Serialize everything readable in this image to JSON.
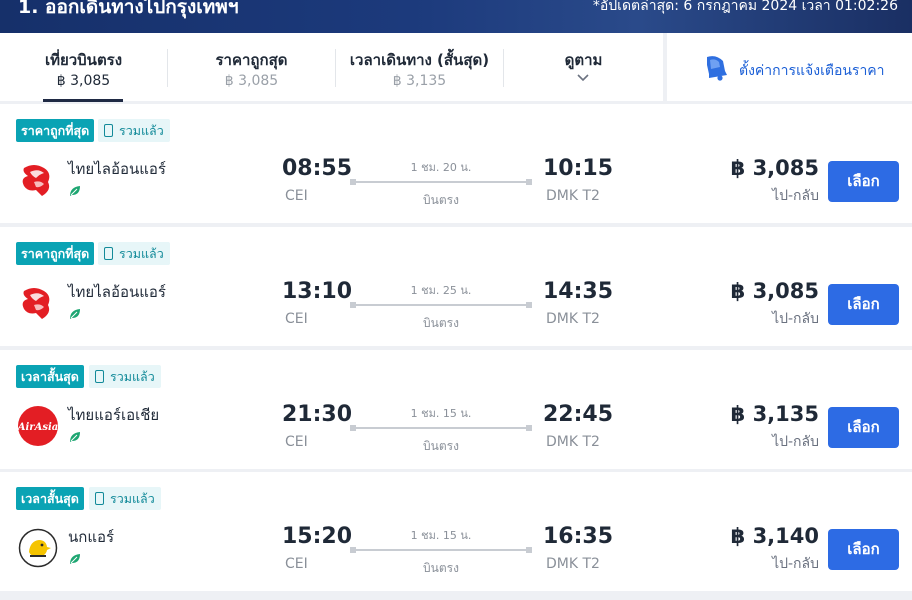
{
  "header": {
    "title": "1. ออกเดินทางไปกรุงเทพฯ",
    "updated": "*อัปเดตล่าสุด: 6 กรกฎาคม 2024 เวลา 01:02:26"
  },
  "sort_tabs": [
    {
      "label": "เที่ยวบินตรง",
      "value": "฿ 3,085",
      "active": true
    },
    {
      "label": "ราคาถูกสุด",
      "value": "฿ 3,085"
    },
    {
      "label": "เวลาเดินทาง (สั้นสุด)",
      "value": "฿ 3,135"
    },
    {
      "label": "ดูตาม"
    }
  ],
  "price_alert": {
    "label": "ตั้งค่าการแจ้งเตือนราคา"
  },
  "flights": [
    {
      "badge": "ราคาถูกที่สุด",
      "included": "รวมแล้ว",
      "airline": "ไทยไลอ้อนแอร์",
      "logo": "thai-lion-air-logo",
      "dep_time": "08:55",
      "dep_code": "CEI",
      "duration": "1 ชม. 20 น.",
      "stops": "บินตรง",
      "arr_time": "10:15",
      "arr_code": "DMK T2",
      "price": "฿ 3,085",
      "trip": "ไป-กลับ",
      "select": "เลือก"
    },
    {
      "badge": "ราคาถูกที่สุด",
      "included": "รวมแล้ว",
      "airline": "ไทยไลอ้อนแอร์",
      "logo": "thai-lion-air-logo",
      "dep_time": "13:10",
      "dep_code": "CEI",
      "duration": "1 ชม. 25 น.",
      "stops": "บินตรง",
      "arr_time": "14:35",
      "arr_code": "DMK T2",
      "price": "฿ 3,085",
      "trip": "ไป-กลับ",
      "select": "เลือก"
    },
    {
      "badge": "เวลาสั้นสุด",
      "included": "รวมแล้ว",
      "airline": "ไทยแอร์เอเชีย",
      "logo": "airasia-logo",
      "dep_time": "21:30",
      "dep_code": "CEI",
      "duration": "1 ชม. 15 น.",
      "stops": "บินตรง",
      "arr_time": "22:45",
      "arr_code": "DMK T2",
      "price": "฿ 3,135",
      "trip": "ไป-กลับ",
      "select": "เลือก"
    },
    {
      "badge": "เวลาสั้นสุด",
      "included": "รวมแล้ว",
      "airline": "นกแอร์",
      "logo": "nok-air-logo",
      "dep_time": "15:20",
      "dep_code": "CEI",
      "duration": "1 ชม. 15 น.",
      "stops": "บินตรง",
      "arr_time": "16:35",
      "arr_code": "DMK T2",
      "price": "฿ 3,140",
      "trip": "ไป-กลับ",
      "select": "เลือก"
    }
  ],
  "colors": {
    "badge": "#0aa3b4",
    "select_button": "#2d6be4",
    "alert_link": "#1b5fd6",
    "header": "#1c3a7c"
  }
}
